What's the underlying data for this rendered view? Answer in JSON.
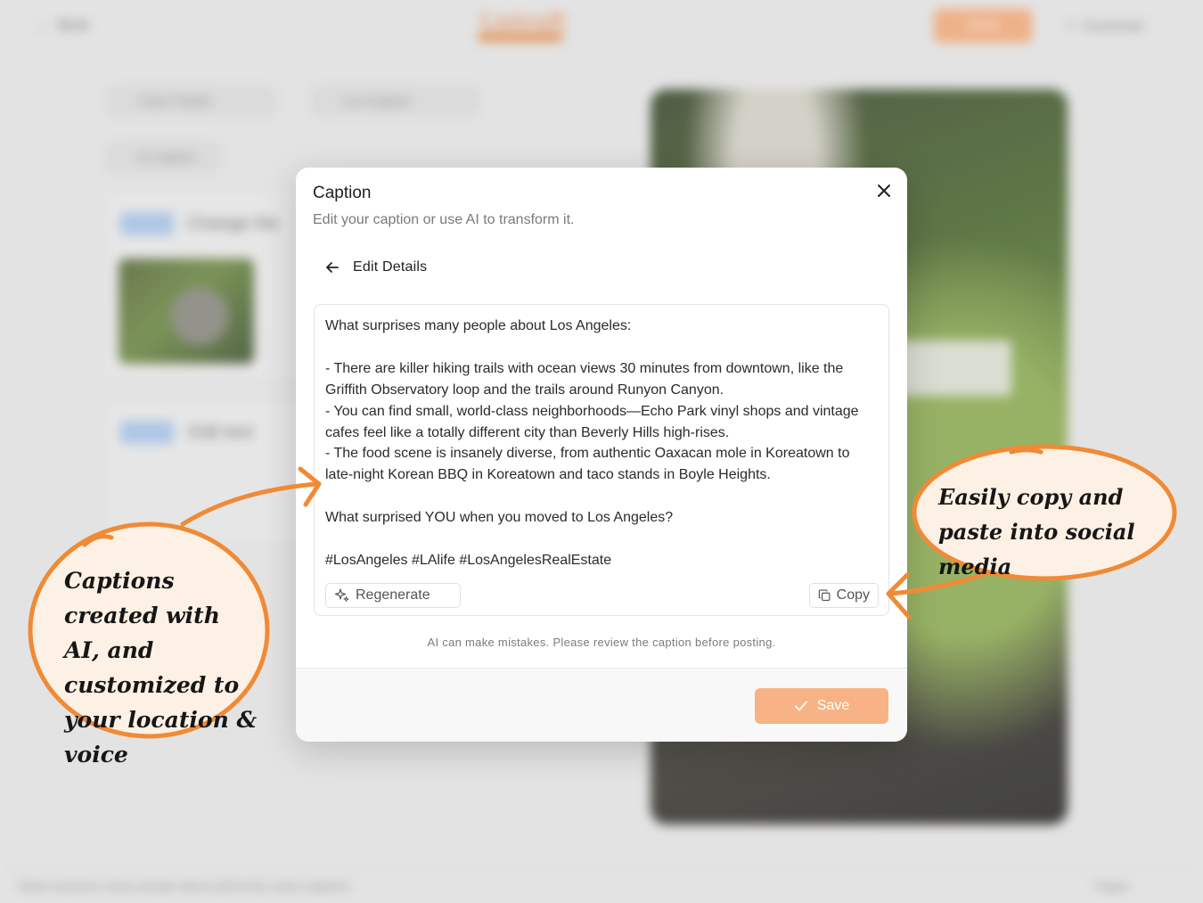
{
  "background": {
    "back_label": "Back",
    "logo_text": "Listraft",
    "share_label": "Share",
    "download_label": "Download",
    "palette_label": "Color Palette",
    "location_label": "Los Angeles",
    "ai_caption_label": "AI Caption",
    "step1_label": "Change the",
    "step2_label": "Edit text",
    "bottom_caption": "What surprises many people about {{SOLD}} coast (caption)",
    "pages_label": "Pages"
  },
  "modal": {
    "title": "Caption",
    "subtitle": "Edit your caption or use AI to transform it.",
    "back_label": "Edit Details",
    "caption_text": "What surprises many people about Los Angeles:\n\n- There are killer hiking trails with ocean views 30 minutes from downtown, like the Griffith Observatory loop and the trails around Runyon Canyon.\n- You can find small, world-class neighborhoods—Echo Park vinyl shops and vintage cafes feel like a totally different city than Beverly Hills high-rises.\n- The food scene is insanely diverse, from authentic Oaxacan mole in Koreatown to late-night Korean BBQ in Koreatown and taco stands in Boyle Heights.\n\nWhat surprised YOU when you moved to Los Angeles?\n\n#LosAngeles #LAlife #LosAngelesRealEstate",
    "regenerate_label": "Regenerate",
    "copy_label": "Copy",
    "disclaimer": "AI can make mistakes. Please review the caption before posting.",
    "save_label": "Save"
  },
  "annotations": {
    "left_callout": "Captions created with AI, and customized to your location & voice",
    "right_callout": "Easily copy and paste into social media"
  },
  "colors": {
    "accent_orange": "#f08a36",
    "save_button": "#f7b385",
    "bubble_fill": "#fdf0e4"
  }
}
